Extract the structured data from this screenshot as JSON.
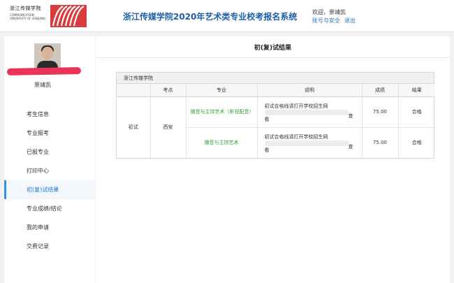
{
  "header": {
    "logo_cn": "浙江传媒学院",
    "logo_en": "COMMUNICATION UNIVERSITY OF ZHEJIANG",
    "site_title": "浙江传媒学院2020年艺术类专业校考报名系统",
    "greeting": "欢迎，景靖凯",
    "link_account": "账号与安全",
    "link_logout": "退出"
  },
  "sidebar": {
    "user_name": "景靖凯",
    "items": [
      {
        "label": "考生信息"
      },
      {
        "label": "专业报考"
      },
      {
        "label": "已报专业"
      },
      {
        "label": "打印中心"
      },
      {
        "label": "初(复)试结果"
      },
      {
        "label": "专业成绩/结论"
      },
      {
        "label": "我的申请"
      },
      {
        "label": "交费记录"
      }
    ],
    "active_index": 4
  },
  "main": {
    "page_title": "初(复)试结果",
    "school_name": "浙江传媒学院",
    "columns": [
      "考点",
      "专业",
      "说明",
      "成绩",
      "结果"
    ],
    "round": "初试",
    "venue": "西安",
    "rows": [
      {
        "major": "播音与主持艺术（影视配音）",
        "desc": "初试合格线请打开学校招生网",
        "desc_view_a": "查",
        "desc_view_b": "看",
        "score": "75.00",
        "result": "合格"
      },
      {
        "major": "播音与主持艺术",
        "desc": "初试合格线请打开学校招生网",
        "desc_view_a": "查",
        "desc_view_b": "看",
        "score": "75.00",
        "result": "合格"
      }
    ]
  }
}
